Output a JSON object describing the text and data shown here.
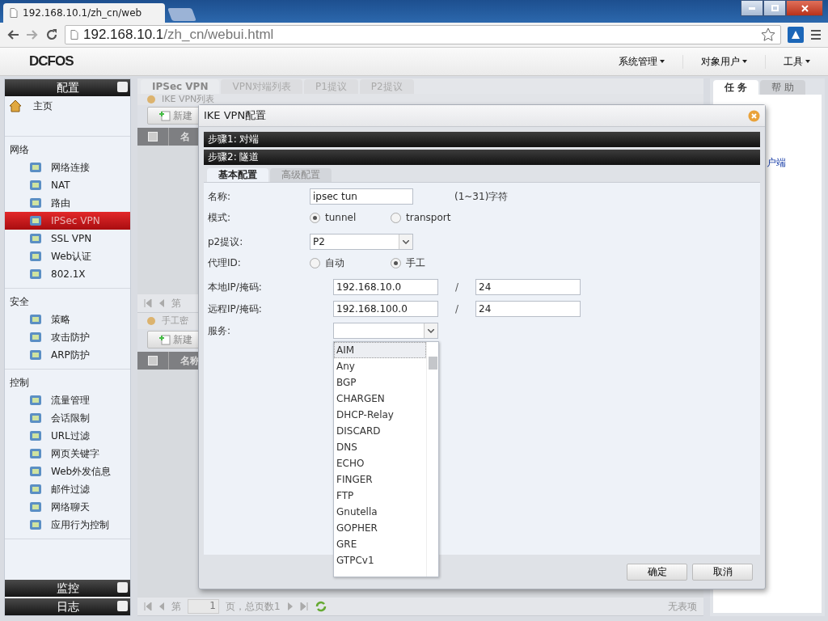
{
  "browser": {
    "tab_title": "192.168.10.1/zh_cn/web",
    "url_host": "192.168.10.1",
    "url_path": "/zh_cn/webui.html"
  },
  "header": {
    "logo": "DCFOS",
    "menus": [
      "系统管理",
      "对象用户",
      "工具"
    ]
  },
  "sidebar": {
    "title": "配置",
    "home": "主页",
    "sections": [
      {
        "label": "网络",
        "items": [
          {
            "label": "网络连接",
            "selected": false
          },
          {
            "label": "NAT",
            "selected": false
          },
          {
            "label": "路由",
            "selected": false
          },
          {
            "label": "IPSec VPN",
            "selected": true
          },
          {
            "label": "SSL VPN",
            "selected": false
          },
          {
            "label": "Web认证",
            "selected": false
          },
          {
            "label": "802.1X",
            "selected": false
          }
        ]
      },
      {
        "label": "安全",
        "items": [
          {
            "label": "策略",
            "selected": false
          },
          {
            "label": "攻击防护",
            "selected": false
          },
          {
            "label": "ARP防护",
            "selected": false
          }
        ]
      },
      {
        "label": "控制",
        "items": [
          {
            "label": "流量管理",
            "selected": false
          },
          {
            "label": "会话限制",
            "selected": false
          },
          {
            "label": "URL过滤",
            "selected": false
          },
          {
            "label": "网页关键字",
            "selected": false
          },
          {
            "label": "Web外发信息",
            "selected": false
          },
          {
            "label": "邮件过滤",
            "selected": false
          },
          {
            "label": "网络聊天",
            "selected": false
          },
          {
            "label": "应用行为控制",
            "selected": false
          }
        ]
      }
    ],
    "footer": [
      "监控",
      "日志"
    ]
  },
  "main": {
    "tabs": [
      {
        "label": "IPSec VPN",
        "selected": true
      },
      {
        "label": "VPN对端列表",
        "selected": false
      },
      {
        "label": "P1提议",
        "selected": false
      },
      {
        "label": "P2提议",
        "selected": false
      }
    ],
    "panels": [
      {
        "title": "IKE VPN列表",
        "new_button": "新建",
        "checked": false,
        "column": "名",
        "pager_label": "第"
      },
      {
        "title": "手工密",
        "new_button": "新建",
        "checked": false,
        "column": "名称",
        "pager_label": "第",
        "page": "1",
        "page_total": "页，总页数1",
        "status": "无表项"
      }
    ]
  },
  "right_panel": {
    "tabs": [
      {
        "label": "任 务",
        "selected": true
      },
      {
        "label": "帮 助",
        "selected": false
      }
    ],
    "link": "户端"
  },
  "dialog": {
    "title": "IKE VPN配置",
    "steps": [
      "步骤1: 对端",
      "步骤2: 隧道"
    ],
    "tabs": [
      {
        "label": "基本配置",
        "selected": true
      },
      {
        "label": "高级配置",
        "selected": false
      }
    ],
    "name": {
      "label": "名称:",
      "value": "ipsec tun",
      "hint": "(1~31)字符"
    },
    "mode": {
      "label": "模式:",
      "options": [
        {
          "label": "tunnel",
          "selected": true
        },
        {
          "label": "transport",
          "selected": false
        }
      ]
    },
    "p2": {
      "label": "p2提议:",
      "value": "P2"
    },
    "proxy_id": {
      "label": "代理ID:",
      "options": [
        {
          "label": "自动",
          "selected": false
        },
        {
          "label": "手工",
          "selected": true
        }
      ]
    },
    "local": {
      "label": "本地IP/掩码:",
      "ip": "192.168.10.0",
      "separator": "/",
      "mask": "24"
    },
    "remote": {
      "label": "远程IP/掩码:",
      "ip": "192.168.100.0",
      "separator": "/",
      "mask": "24"
    },
    "service": {
      "label": "服务:",
      "options": [
        {
          "label": "AIM",
          "selected": true
        },
        {
          "label": "Any",
          "selected": false
        },
        {
          "label": "BGP",
          "selected": false
        },
        {
          "label": "CHARGEN",
          "selected": false
        },
        {
          "label": "DHCP-Relay",
          "selected": false
        },
        {
          "label": "DISCARD",
          "selected": false
        },
        {
          "label": "DNS",
          "selected": false
        },
        {
          "label": "ECHO",
          "selected": false
        },
        {
          "label": "FINGER",
          "selected": false
        },
        {
          "label": "FTP",
          "selected": false
        },
        {
          "label": "Gnutella",
          "selected": false
        },
        {
          "label": "GOPHER",
          "selected": false
        },
        {
          "label": "GRE",
          "selected": false
        },
        {
          "label": "GTPCv1",
          "selected": false
        }
      ]
    },
    "buttons": [
      "确定",
      "取消"
    ]
  }
}
